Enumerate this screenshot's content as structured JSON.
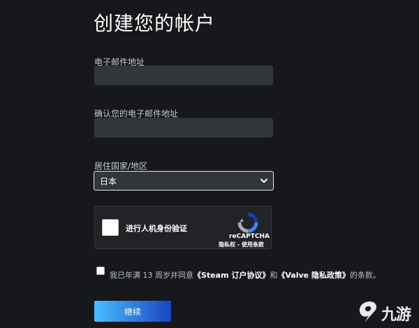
{
  "page": {
    "title": "创建您的帐户"
  },
  "form": {
    "email_label": "电子邮件地址",
    "email_value": "",
    "confirm_email_label": "确认您的电子邮件地址",
    "confirm_email_value": "",
    "country_label": "居住国家/地区",
    "country_selected": "日本"
  },
  "captcha": {
    "checkbox_label": "进行人机身份验证",
    "brand": "reCAPTCHA",
    "links": "隐私权 - 使用条款",
    "checked": false
  },
  "agreement": {
    "checked": false,
    "prefix": "我已年满 13 周岁并同意",
    "steam_link": "《Steam 订户协议》",
    "conjunction": "和",
    "valve_link": "《Valve 隐私政策》",
    "suffix": "的条款。"
  },
  "submit": {
    "label": "继续"
  },
  "watermark": {
    "text": "九游",
    "icon": "jiuyou-logo-icon"
  },
  "colors": {
    "background": "#17181c",
    "field": "#32353c",
    "button_start": "#47bfff",
    "button_end": "#1a44c2"
  }
}
